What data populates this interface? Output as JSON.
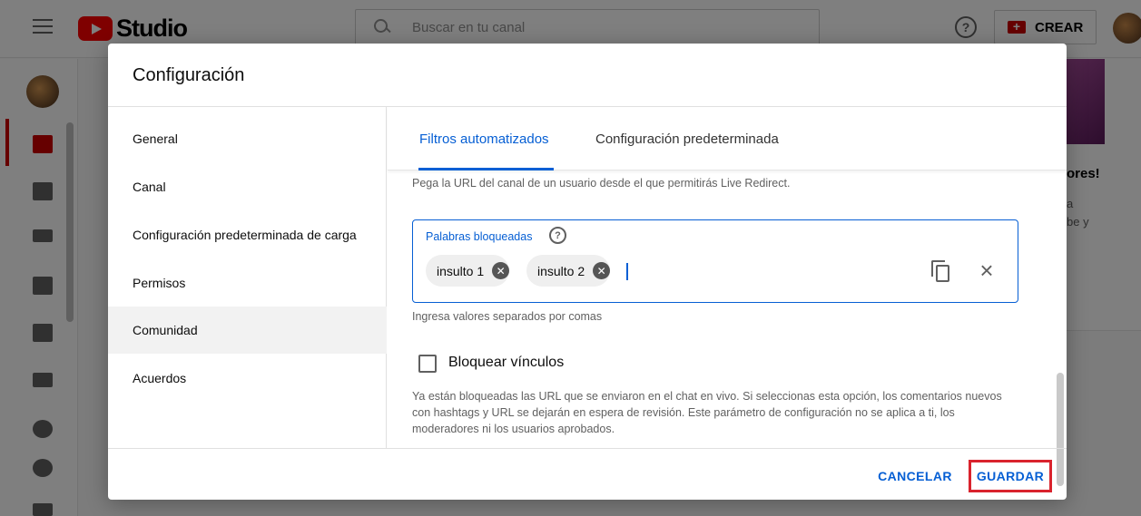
{
  "header": {
    "logo_text": "Studio",
    "search_placeholder": "Buscar en tu canal",
    "help_glyph": "?",
    "create_label": "CREAR"
  },
  "background_card": {
    "title_fragment": "ores!",
    "text_fragment_1": "a",
    "text_fragment_2": "be y"
  },
  "dialog": {
    "title": "Configuración",
    "nav": [
      {
        "label": "General"
      },
      {
        "label": "Canal"
      },
      {
        "label": "Configuración predeterminada de carga"
      },
      {
        "label": "Permisos"
      },
      {
        "label": "Comunidad"
      },
      {
        "label": "Acuerdos"
      }
    ],
    "active_nav": "Comunidad",
    "tabs": [
      {
        "label": "Filtros automatizados"
      },
      {
        "label": "Configuración predeterminada"
      }
    ],
    "active_tab": "Filtros automatizados",
    "hint_top": "Pega la URL del canal de un usuario desde el que permitirás Live Redirect.",
    "blocked_words": {
      "label": "Palabras bloqueadas",
      "help_glyph": "?",
      "chips": [
        "insulto 1",
        "insulto 2"
      ],
      "chip_remove_glyph": "✕",
      "clear_glyph": "×",
      "hint": "Ingresa valores separados por comas"
    },
    "block_links": {
      "label": "Bloquear vínculos",
      "checked": false,
      "description": "Ya están bloqueadas las URL que se enviaron en el chat en vivo. Si seleccionas esta opción, los comentarios nuevos con hashtags y URL se dejarán en espera de revisión. Este parámetro de configuración no se aplica a ti, los moderadores ni los usuarios aprobados."
    },
    "buttons": {
      "cancel": "CANCELAR",
      "save": "GUARDAR"
    }
  },
  "colors": {
    "accent": "#065fd4",
    "brand_red": "#ff0000",
    "highlight_box": "#d9232d"
  }
}
